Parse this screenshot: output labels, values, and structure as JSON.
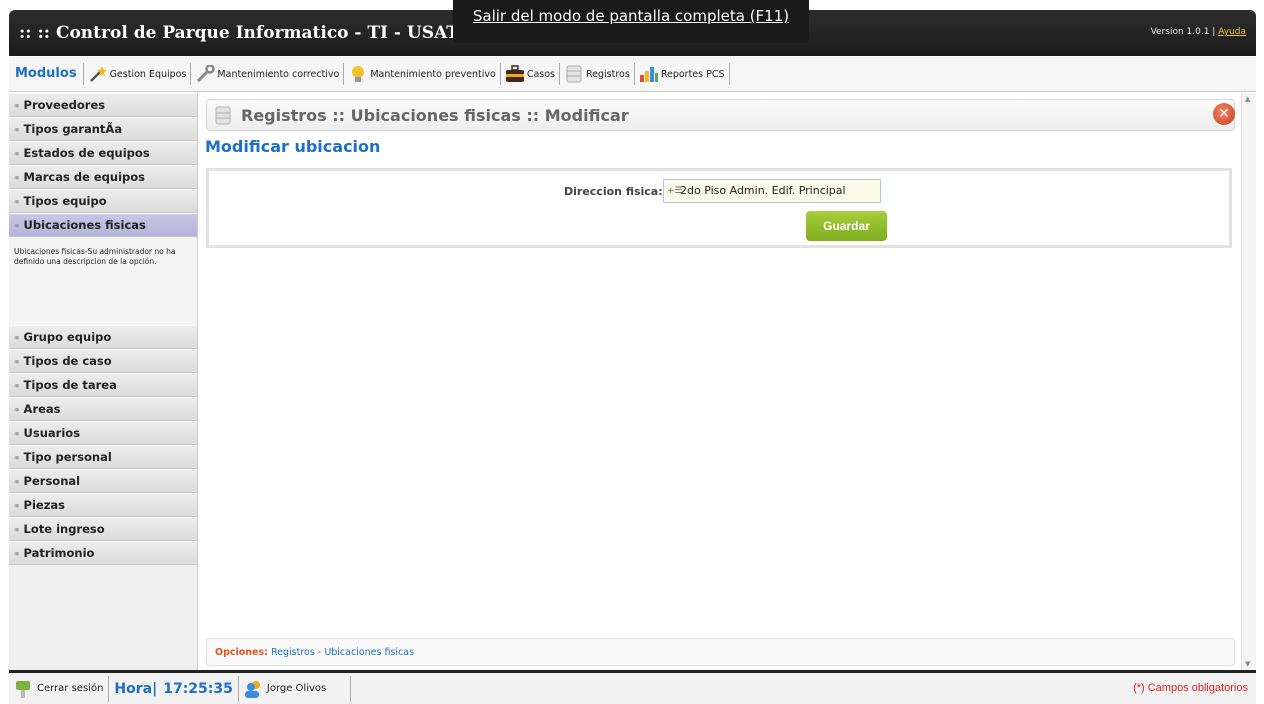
{
  "header": {
    "title": ":: :: Control de Parque Informatico - TI - USAT",
    "version": "Version 1.0.1 |",
    "help_link": "Ayuda"
  },
  "fullscreen_notice": "Salir del modo de pantalla completa (F11)",
  "modules": {
    "label": "Modulos",
    "items": [
      {
        "label": "Gestion Equipos",
        "icon": "magic-wand-icon"
      },
      {
        "label": "Mantenimiento correctivo",
        "icon": "wrench-icon"
      },
      {
        "label": "Mantenimiento preventivo",
        "icon": "lightbulb-icon"
      },
      {
        "label": "Casos",
        "icon": "briefcase-icon"
      },
      {
        "label": "Registros",
        "icon": "database-icon"
      },
      {
        "label": "Reportes PCS",
        "icon": "bar-chart-icon"
      }
    ]
  },
  "sidebar": {
    "items_top": [
      {
        "label": "Proveedores"
      },
      {
        "label": "Tipos garantÃa"
      },
      {
        "label": "Estados de equipos"
      },
      {
        "label": "Marcas de equipos"
      },
      {
        "label": "Tipos equipo"
      }
    ],
    "active_item": {
      "label": "Ubicaciones fisicas"
    },
    "active_description": "Ubicaciones fisicas-Su administrador no ha definido una descripcion de la opción.",
    "items_bottom": [
      {
        "label": "Grupo equipo"
      },
      {
        "label": "Tipos de caso"
      },
      {
        "label": "Tipos de tarea"
      },
      {
        "label": "Areas"
      },
      {
        "label": "Usuarios"
      },
      {
        "label": "Tipo personal"
      },
      {
        "label": "Personal"
      },
      {
        "label": "Piezas"
      },
      {
        "label": "Lote ingreso"
      },
      {
        "label": "Patrimonio"
      }
    ]
  },
  "main": {
    "breadcrumb": "Registros :: Ubicaciones fisicas :: Modificar",
    "form_title": "Modificar ubicacion",
    "field_label": "Direccion fisica:",
    "field_value": "2do Piso Admin. Edif. Principal",
    "save_label": "Guardar",
    "options_label": "Opciones:",
    "options_link_1": "Registros",
    "options_sep": "-",
    "options_link_2": "Ubicaciones fisicas"
  },
  "footer": {
    "logout_label": "Cerrar sesión",
    "hora_label": "Hora|",
    "time": "17:25:35",
    "user_name": "Jorge Olivos",
    "required_note": "(*) Campos obligatorios"
  },
  "colors": {
    "accent_blue": "#1d6fc7",
    "save_green": "#8bbb25",
    "close_red": "#d9532f",
    "active_sidebar": "#bcbadd"
  }
}
